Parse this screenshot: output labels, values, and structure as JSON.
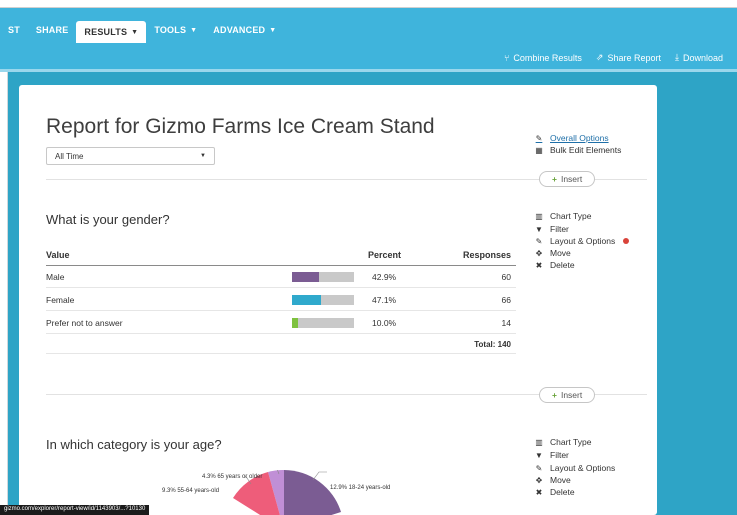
{
  "nav": {
    "items": [
      {
        "label": "ST",
        "caret": false,
        "active": false
      },
      {
        "label": "SHARE",
        "caret": false,
        "active": false
      },
      {
        "label": "RESULTS",
        "caret": true,
        "active": true
      },
      {
        "label": "TOOLS",
        "caret": true,
        "active": false
      },
      {
        "label": "ADVANCED",
        "caret": true,
        "active": false
      }
    ],
    "actions": {
      "combine": "Combine Results",
      "share": "Share Report",
      "download": "Download"
    }
  },
  "report": {
    "title": "Report for Gizmo Farms Ice Cream Stand",
    "date_range": "All Time"
  },
  "sidebar_top": {
    "overall_options": "Overall Options",
    "bulk_edit": "Bulk Edit Elements"
  },
  "insert_label": "Insert",
  "element_menu": {
    "chart_type": "Chart Type",
    "filter": "Filter",
    "layout": "Layout & Options",
    "move": "Move",
    "delete": "Delete"
  },
  "question1": {
    "title": "What is your gender?",
    "headers": {
      "value": "Value",
      "percent": "Percent",
      "responses": "Responses"
    },
    "rows": [
      {
        "value": "Male",
        "percent": "42.9%",
        "responses": "60",
        "fraction": 0.429,
        "color": "#7b5c93"
      },
      {
        "value": "Female",
        "percent": "47.1%",
        "responses": "66",
        "fraction": 0.471,
        "color": "#2fa9cc"
      },
      {
        "value": "Prefer not to answer",
        "percent": "10.0%",
        "responses": "14",
        "fraction": 0.1,
        "color": "#7ec13f"
      }
    ],
    "total": "Total: 140"
  },
  "question2": {
    "title": "In which category is your age?",
    "pie_labels": {
      "a": "4.3% 65 years or older",
      "b": "9.3% 55-64 years-old",
      "c": "12.9% 18-24 years-old"
    }
  },
  "status_url": "gizmo.com/explorer/report-view/id/1143903/...?10130",
  "colors": {
    "topbar": "#3fb4dc",
    "background": "#2ea4c6",
    "link": "#1e6fa8",
    "insert_plus": "#6aa33b"
  }
}
